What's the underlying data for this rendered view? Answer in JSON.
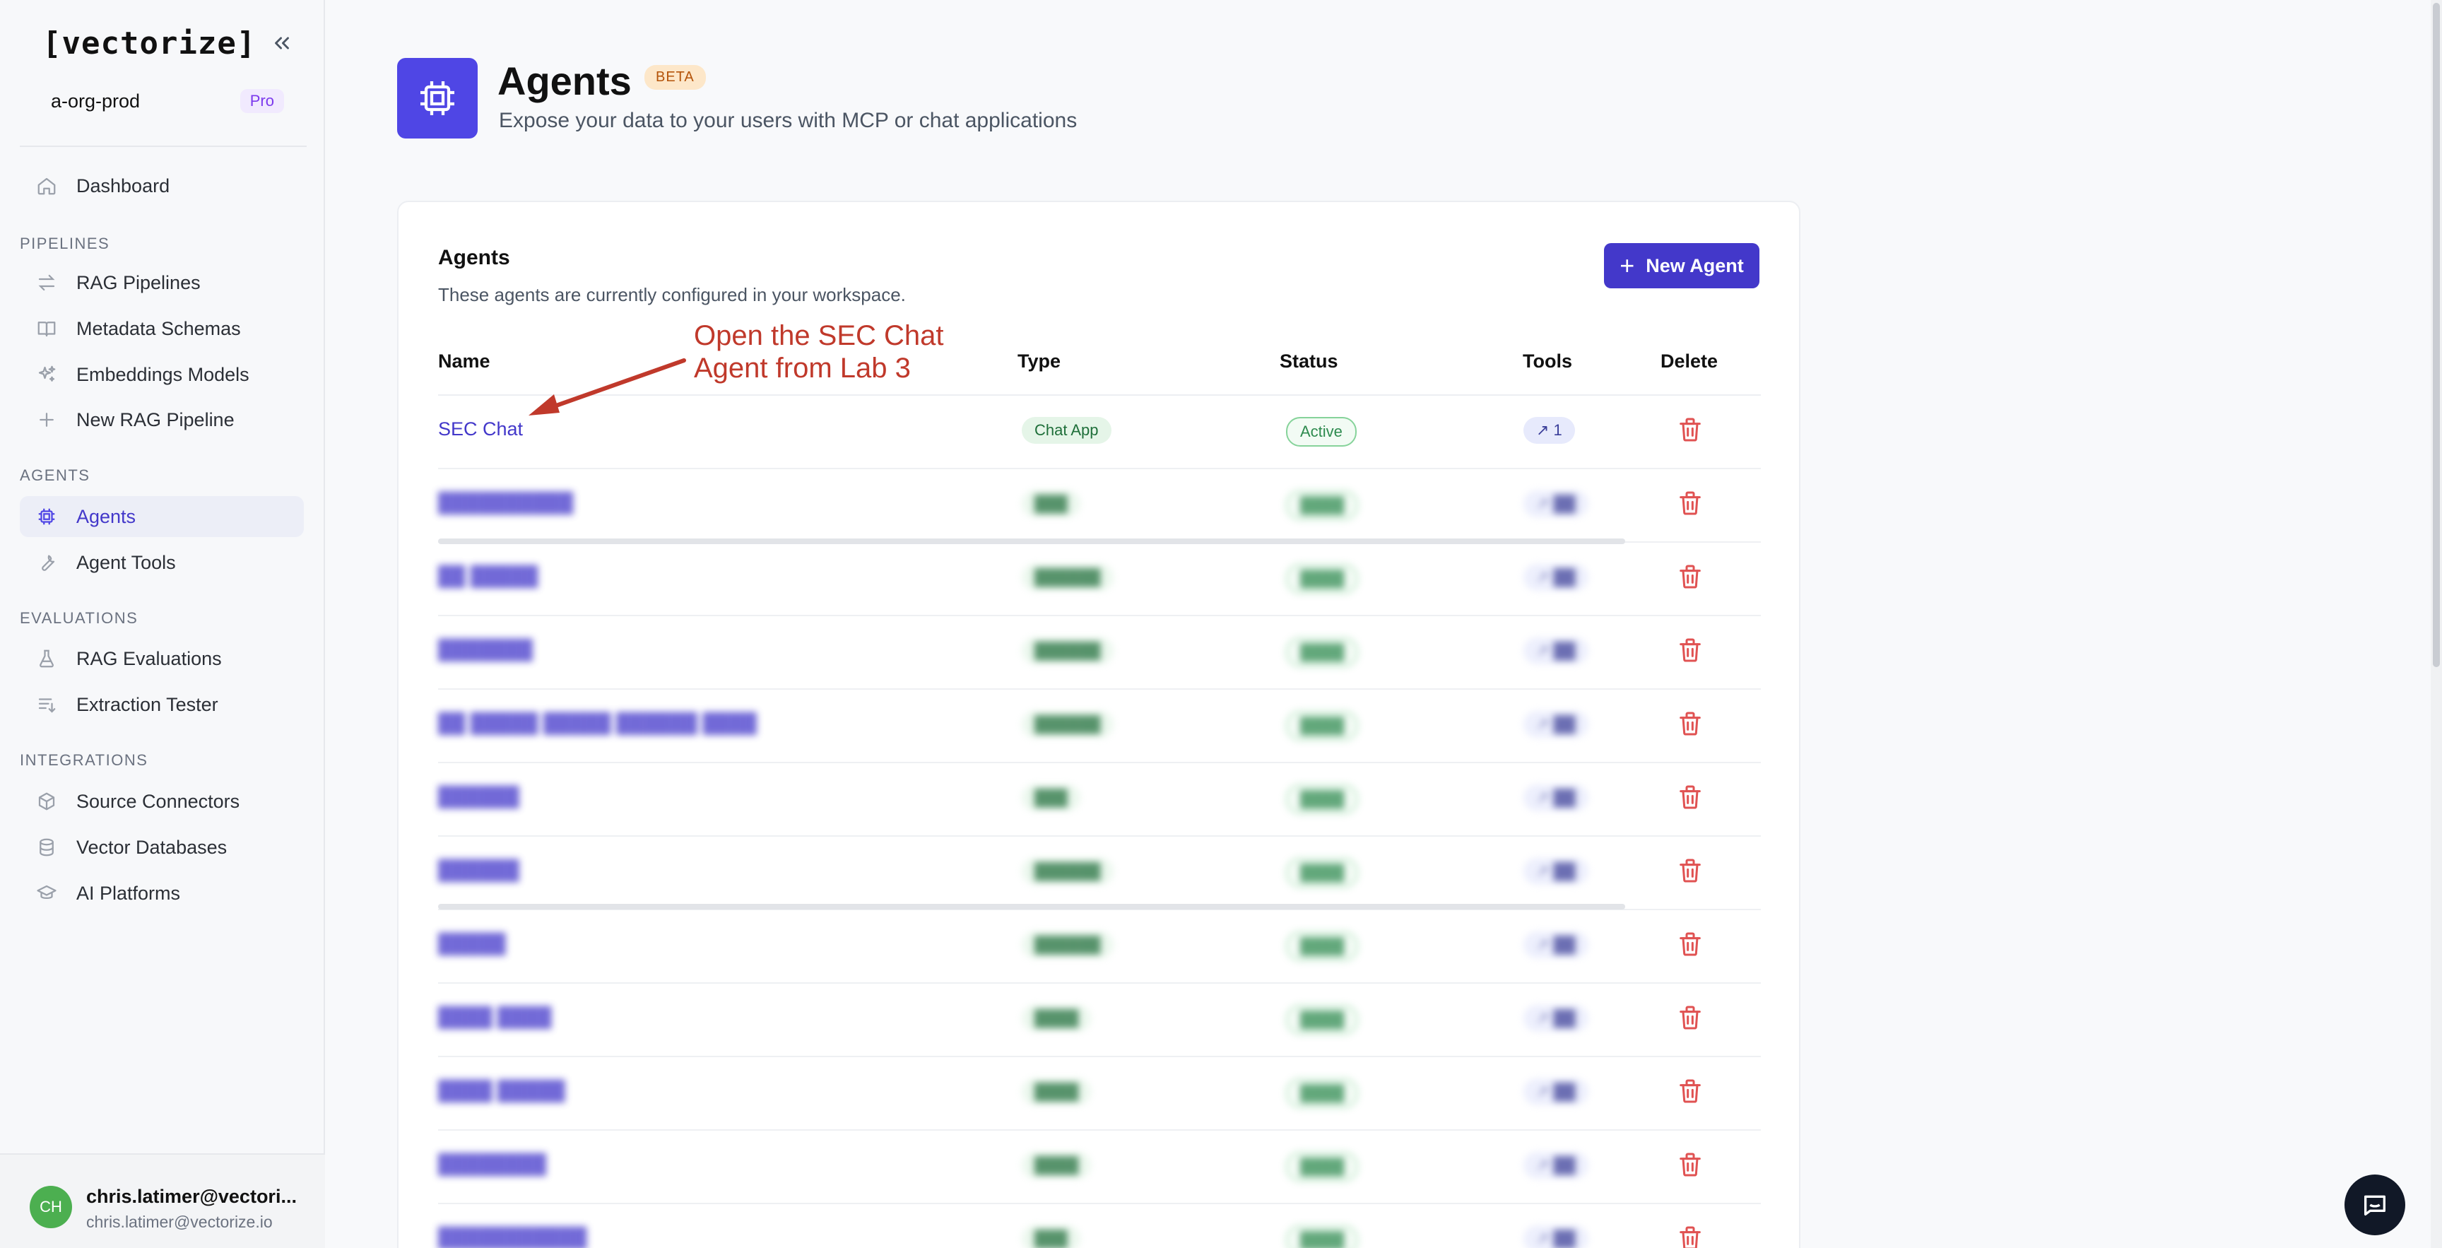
{
  "brand": "[vectorize]",
  "org": {
    "name": "a-org-prod",
    "plan": "Pro"
  },
  "sidebar": {
    "dashboard": {
      "label": "Dashboard",
      "icon": "home-icon"
    },
    "sections": [
      {
        "heading": "PIPELINES",
        "items": [
          {
            "label": "RAG Pipelines",
            "icon": "arrows-swap-icon"
          },
          {
            "label": "Metadata Schemas",
            "icon": "book-open-icon"
          },
          {
            "label": "Embeddings Models",
            "icon": "sparkles-icon"
          },
          {
            "label": "New RAG Pipeline",
            "icon": "plus-icon"
          }
        ]
      },
      {
        "heading": "AGENTS",
        "items": [
          {
            "label": "Agents",
            "icon": "cpu-chip-icon",
            "active": true
          },
          {
            "label": "Agent Tools",
            "icon": "wrench-icon"
          }
        ]
      },
      {
        "heading": "EVALUATIONS",
        "items": [
          {
            "label": "RAG Evaluations",
            "icon": "beaker-icon"
          },
          {
            "label": "Extraction Tester",
            "icon": "list-sort-icon"
          }
        ]
      },
      {
        "heading": "INTEGRATIONS",
        "items": [
          {
            "label": "Source Connectors",
            "icon": "cube-icon"
          },
          {
            "label": "Vector Databases",
            "icon": "database-icon"
          },
          {
            "label": "AI Platforms",
            "icon": "academic-cap-icon"
          }
        ]
      }
    ]
  },
  "user": {
    "initials": "CH",
    "name": "chris.latimer@vectori...",
    "email": "chris.latimer@vectorize.io"
  },
  "header": {
    "title": "Agents",
    "badge": "BETA",
    "subtitle": "Expose your data to your users with MCP or chat applications"
  },
  "card": {
    "title": "Agents",
    "subtitle": "These agents are currently configured in your workspace.",
    "new_button": "New Agent"
  },
  "table": {
    "columns": [
      "Name",
      "Type",
      "Status",
      "Tools",
      "Delete"
    ],
    "rows": [
      {
        "name": "SEC Chat",
        "type": "Chat App",
        "status": "Active",
        "tools": "1"
      },
      {
        "name": "██████████",
        "type": "███",
        "status": "████",
        "tools": "██"
      },
      {
        "name": "██ █████",
        "type": "██████",
        "status": "████",
        "tools": "██"
      },
      {
        "name": "███████",
        "type": "██████",
        "status": "████",
        "tools": "██"
      },
      {
        "name": "██ █████ █████ ██████ ████",
        "type": "██████",
        "status": "████",
        "tools": "██"
      },
      {
        "name": "██████",
        "type": "███",
        "status": "████",
        "tools": "██"
      },
      {
        "name": "██████",
        "type": "██████",
        "status": "████",
        "tools": "██"
      },
      {
        "name": "█████",
        "type": "██████",
        "status": "████",
        "tools": "██"
      },
      {
        "name": "████ ████",
        "type": "████",
        "status": "████",
        "tools": "██"
      },
      {
        "name": "████ █████",
        "type": "████",
        "status": "████",
        "tools": "██"
      },
      {
        "name": "████████",
        "type": "████",
        "status": "████",
        "tools": "██"
      },
      {
        "name": "███████████",
        "type": "███",
        "status": "████",
        "tools": "██"
      }
    ]
  },
  "annotation": "Open the SEC Chat\nAgent from Lab 3",
  "colors": {
    "accent": "#4338ca",
    "annotation": "#c0392b",
    "delete": "#e05252"
  }
}
